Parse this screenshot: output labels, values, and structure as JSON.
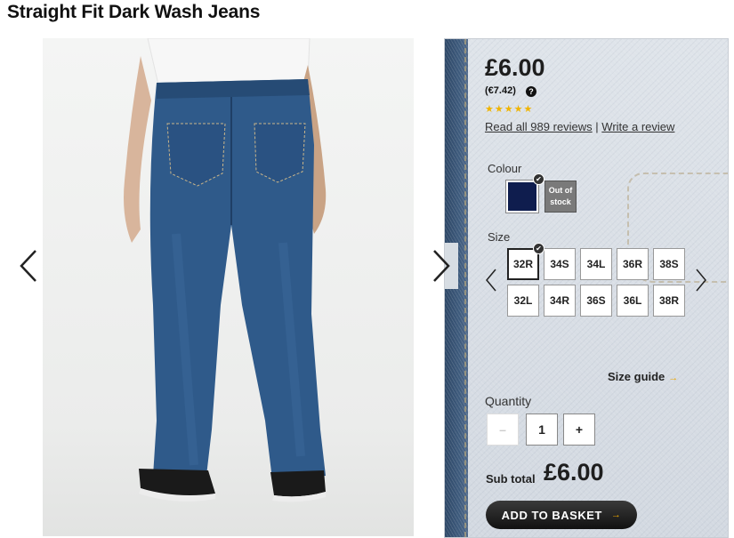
{
  "product": {
    "title": "Straight Fit Dark Wash Jeans",
    "price": "£6.00",
    "price_euro": "(€7.42)",
    "rating_stars": "★★★★★",
    "reviews_link": "Read all 989 reviews",
    "review_separator": " | ",
    "write_review_link": "Write a review"
  },
  "colour": {
    "label": "Colour",
    "options": [
      {
        "name": "navy",
        "color": "#0f1d4e",
        "selected": true
      },
      {
        "name": "out-of-stock",
        "text": "Out of stock"
      }
    ]
  },
  "size": {
    "label": "Size",
    "options": [
      "32R",
      "34S",
      "34L",
      "36R",
      "38S",
      "32L",
      "34R",
      "36S",
      "36L",
      "38R"
    ],
    "selected": "32R",
    "guide_label": "Size guide"
  },
  "quantity": {
    "label": "Quantity",
    "minus": "–",
    "value": "1",
    "plus": "+"
  },
  "subtotal": {
    "label": "Sub total",
    "value": "£6.00"
  },
  "actions": {
    "add_to_basket": "ADD TO BASKET"
  },
  "icons": {
    "help": "?",
    "check": "✔",
    "arrow": "→"
  }
}
